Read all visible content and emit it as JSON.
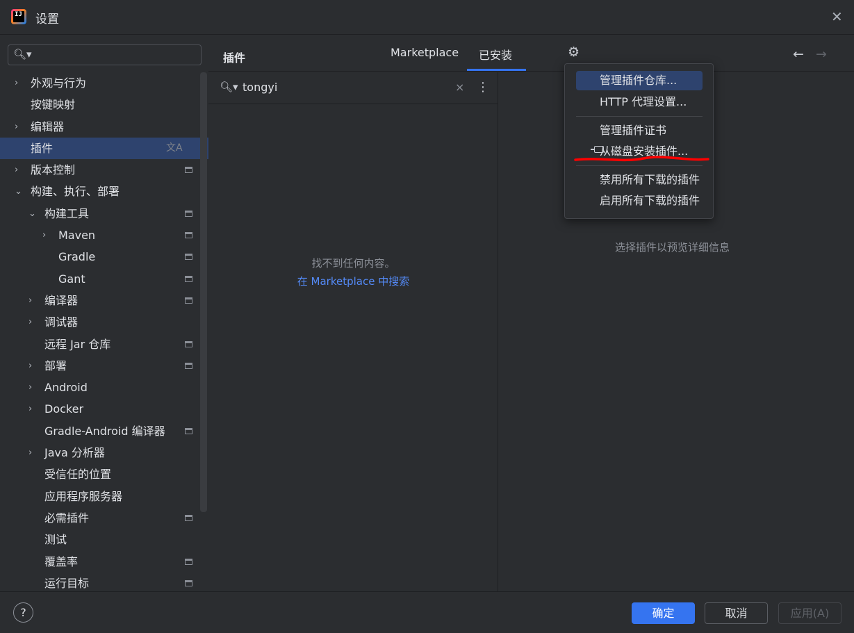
{
  "window": {
    "title": "设置",
    "logo_text": "IJ"
  },
  "sidebar": {
    "search_icon": "search-icon",
    "items": [
      {
        "label": "外观与行为",
        "chevron": "›",
        "level": 0
      },
      {
        "label": "按键映射",
        "chevron": "",
        "level": 0
      },
      {
        "label": "编辑器",
        "chevron": "›",
        "level": 0
      },
      {
        "label": "插件",
        "chevron": "",
        "level": 0
      },
      {
        "label": "版本控制",
        "chevron": "›",
        "level": 0
      },
      {
        "label": "构建、执行、部署",
        "chevron": "⌄",
        "level": 0
      },
      {
        "label": "构建工具",
        "chevron": "⌄",
        "level": 1
      },
      {
        "label": "Maven",
        "chevron": "›",
        "level": 2
      },
      {
        "label": "Gradle",
        "chevron": "",
        "level": 2
      },
      {
        "label": "Gant",
        "chevron": "",
        "level": 2
      },
      {
        "label": "编译器",
        "chevron": "›",
        "level": 1
      },
      {
        "label": "调试器",
        "chevron": "›",
        "level": 1
      },
      {
        "label": "远程 Jar 仓库",
        "chevron": "",
        "level": 1
      },
      {
        "label": "部署",
        "chevron": "›",
        "level": 1
      },
      {
        "label": "Android",
        "chevron": "›",
        "level": 1
      },
      {
        "label": "Docker",
        "chevron": "›",
        "level": 1
      },
      {
        "label": "Gradle-Android 编译器",
        "chevron": "",
        "level": 1
      },
      {
        "label": "Java 分析器",
        "chevron": "›",
        "level": 1
      },
      {
        "label": "受信任的位置",
        "chevron": "",
        "level": 1
      },
      {
        "label": "应用程序服务器",
        "chevron": "",
        "level": 1
      },
      {
        "label": "必需插件",
        "chevron": "",
        "level": 1
      },
      {
        "label": "测试",
        "chevron": "",
        "level": 1
      },
      {
        "label": "覆盖率",
        "chevron": "",
        "level": 1
      },
      {
        "label": "运行目标",
        "chevron": "",
        "level": 1
      }
    ],
    "translate_glyph": "文A"
  },
  "header": {
    "title": "插件",
    "tabs": [
      {
        "label": "Marketplace"
      },
      {
        "label": "已安装"
      }
    ],
    "gear_glyph": "⚙",
    "back_glyph": "←",
    "forward_glyph": "→"
  },
  "list": {
    "search_value": "tongyi",
    "clear_glyph": "×",
    "more_glyph": "⋮",
    "empty_message": "找不到任何内容。",
    "empty_link": "在 Marketplace 中搜索"
  },
  "detail": {
    "hint": "选择插件以预览详细信息"
  },
  "dropdown": {
    "items": [
      {
        "label": "管理插件仓库..."
      },
      {
        "label": "HTTP 代理设置..."
      },
      {
        "label": "管理插件证书"
      },
      {
        "label": "从磁盘安装插件..."
      },
      {
        "label": "禁用所有下载的插件"
      },
      {
        "label": "启用所有下载的插件"
      }
    ]
  },
  "footer": {
    "help_glyph": "?",
    "ok_label": "确定",
    "cancel_label": "取消",
    "apply_label": "应用(A)"
  },
  "colors": {
    "accent": "#3574f0",
    "selection": "#2e436e",
    "link": "#548af7",
    "annotation": "#ff0000"
  }
}
